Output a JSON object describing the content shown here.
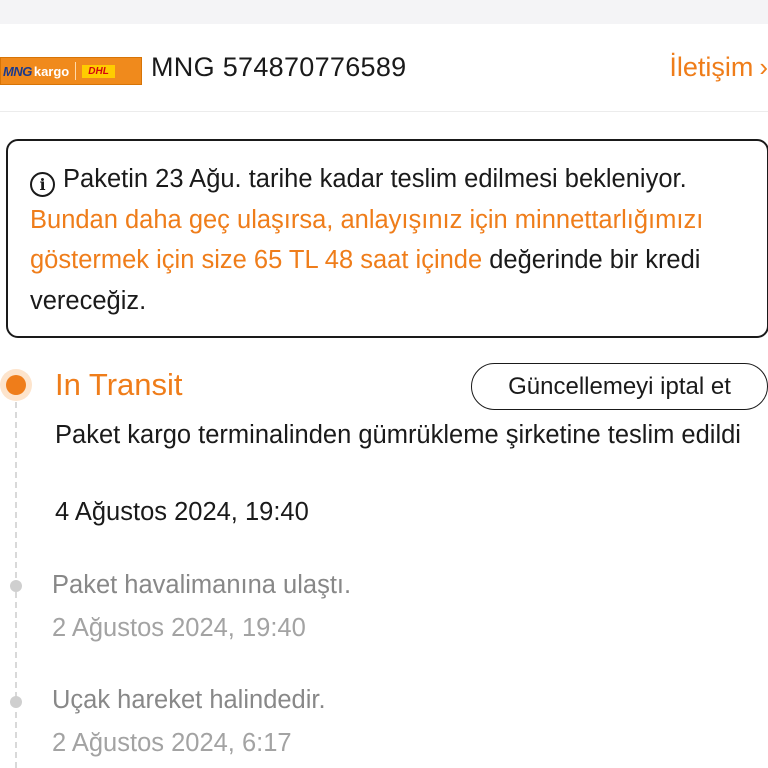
{
  "header": {
    "logo": {
      "mng": "MNG",
      "kargo": "kargo",
      "dhl": "DHL"
    },
    "tracking_number": "MNG 574870776589",
    "contact_label": "İletişim",
    "contact_chevron": "›"
  },
  "notice": {
    "icon": "info-icon",
    "text_before": "Paketin 23 Ağu. tarihe kadar teslim edilmesi bekleniyor.",
    "text_highlight": "Bundan daha geç ulaşırsa, anlayışınız için minnettarlığımızı göstermek için size 65 TL 48 saat içinde",
    "text_after": "değerinde bir kredi vereceğiz."
  },
  "tracking_events": [
    {
      "status": "In Transit",
      "description": "Paket kargo terminalinden gümrükleme şirketine teslim edildi",
      "time": "4 Ağustos 2024, 19:40",
      "active": true
    },
    {
      "description": "Paket havalimanına ulaştı.",
      "time": "2 Ağustos 2024, 19:40",
      "active": false
    },
    {
      "description": "Uçak hareket halindedir.",
      "time": "2 Ağustos 2024, 6:17",
      "active": false
    }
  ],
  "cancel_update_label": "Güncellemeyi iptal et",
  "colors": {
    "accent": "#ef7d1a",
    "text": "#1a1a1a",
    "muted_text": "#888888",
    "timeline_dot": "#cfcfcf"
  }
}
